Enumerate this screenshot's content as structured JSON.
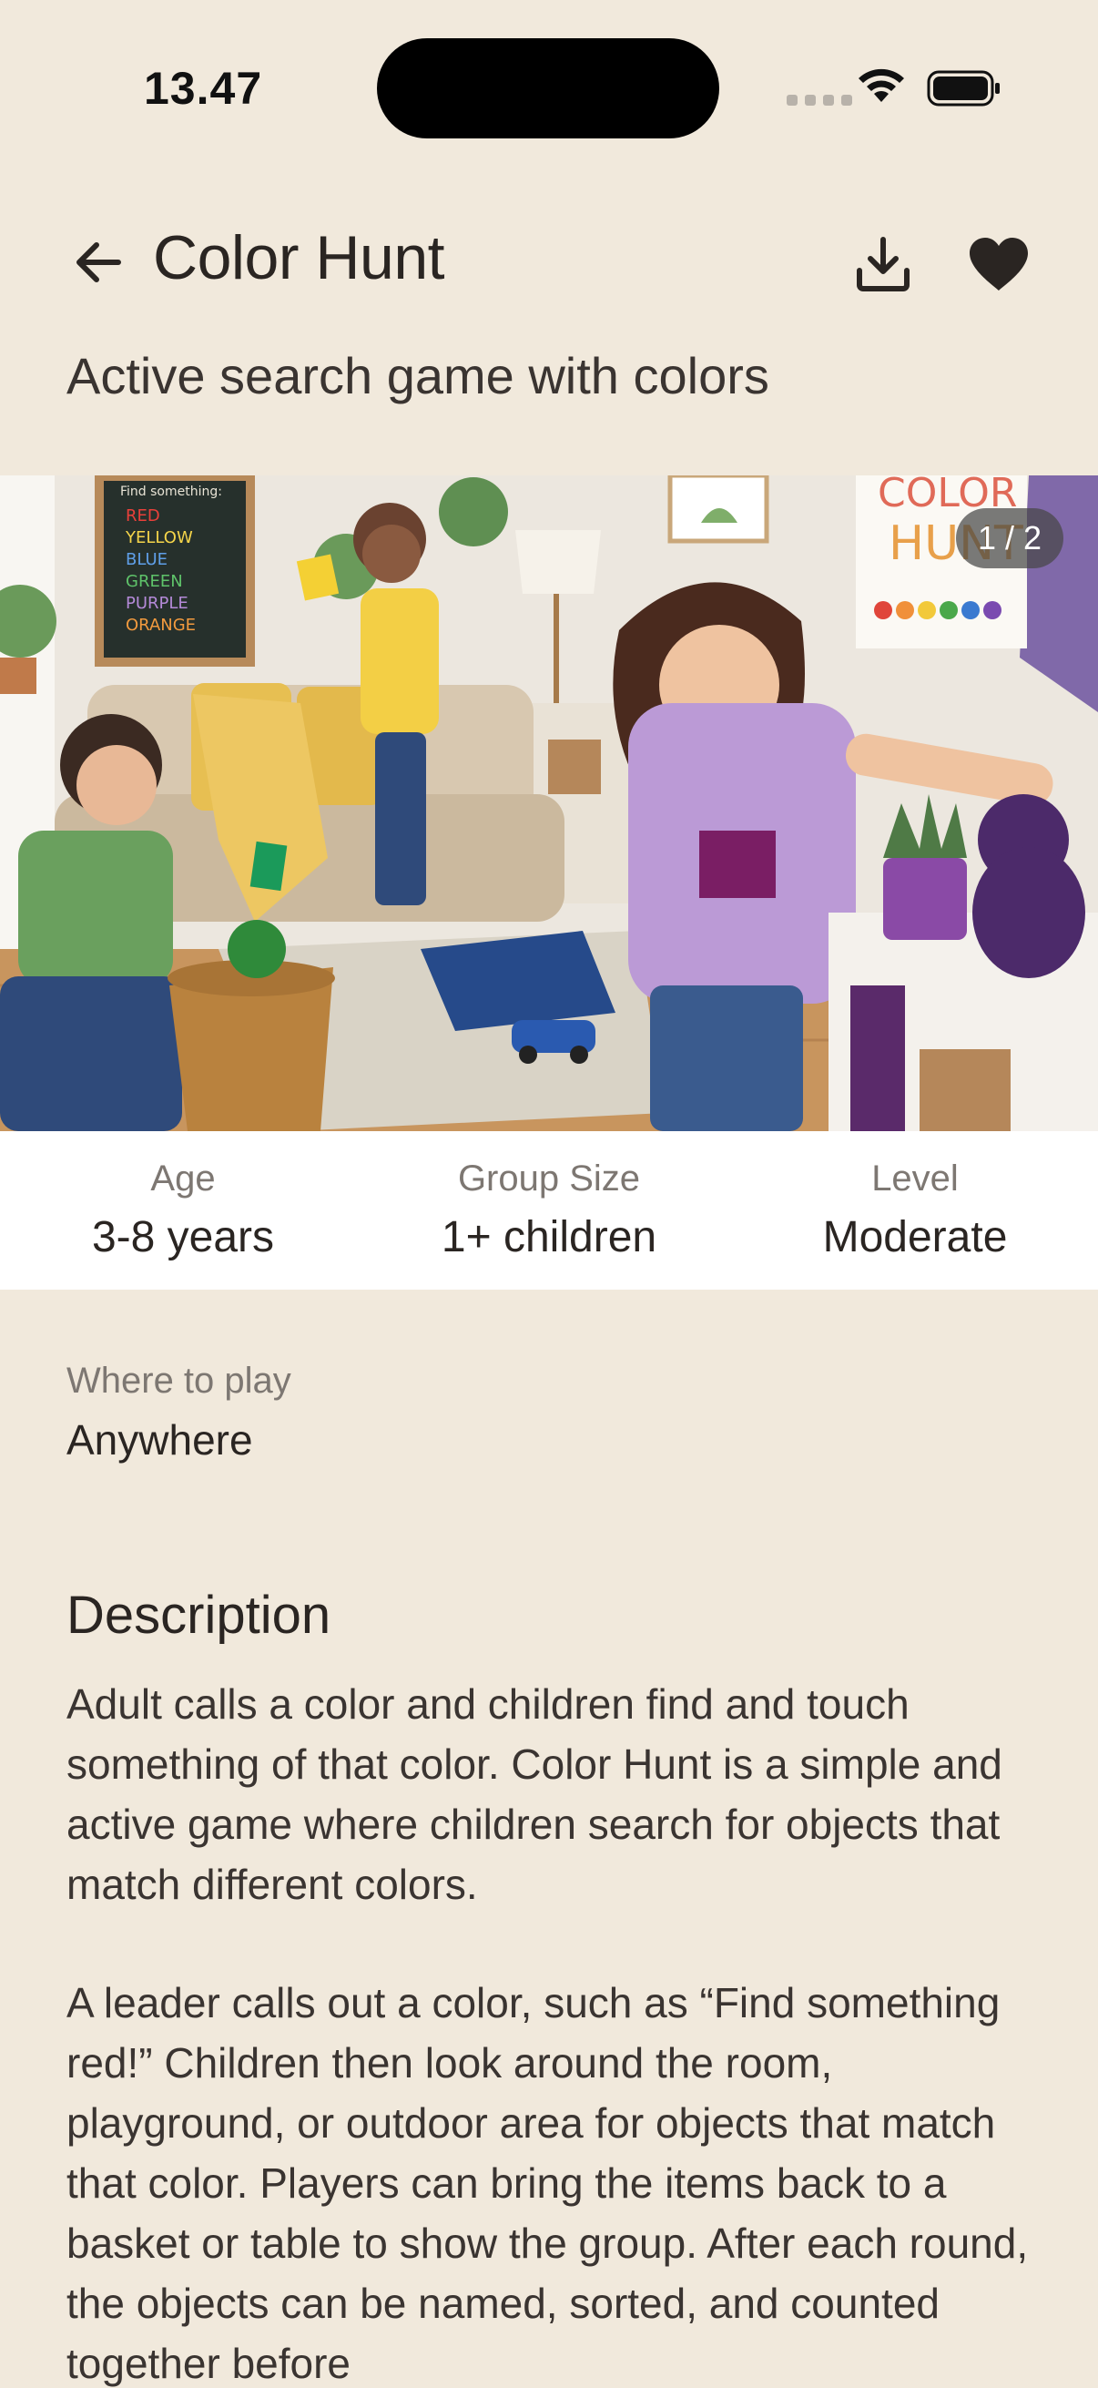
{
  "status_bar": {
    "time": "13.47"
  },
  "header": {
    "title": "Color Hunt",
    "subtitle": "Active search game with colors",
    "back_icon": "arrow-left-icon",
    "download_icon": "download-icon",
    "favorite_icon": "heart-icon"
  },
  "gallery": {
    "counter": "1 / 2",
    "current": 1,
    "total": 2
  },
  "chalkboard": {
    "heading": "Find something:",
    "colors": [
      "RED",
      "YELLOW",
      "BLUE",
      "GREEN",
      "PURPLE",
      "ORANGE"
    ]
  },
  "poster": {
    "line1": "COLOR",
    "line2": "HUNT"
  },
  "stats": [
    {
      "label": "Age",
      "value": "3-8 years"
    },
    {
      "label": "Group Size",
      "value": "1+ children"
    },
    {
      "label": "Level",
      "value": "Moderate"
    }
  ],
  "where": {
    "label": "Where to play",
    "value": "Anywhere"
  },
  "description": {
    "heading": "Description",
    "p1": "Adult calls a color and children find and touch something of that color. Color Hunt is a simple and active game where children search for objects that match different colors.",
    "p2": "A leader calls out a color, such as “Find something red!” Children then look around the room, playground, or outdoor area for objects that match that color. Players can bring the items back to a basket or table to show the group. After each round, the objects can be named, sorted, and counted together before"
  },
  "colors": {
    "background": "#f1e9dc",
    "text": "#2a2522",
    "muted": "#7d7772"
  }
}
